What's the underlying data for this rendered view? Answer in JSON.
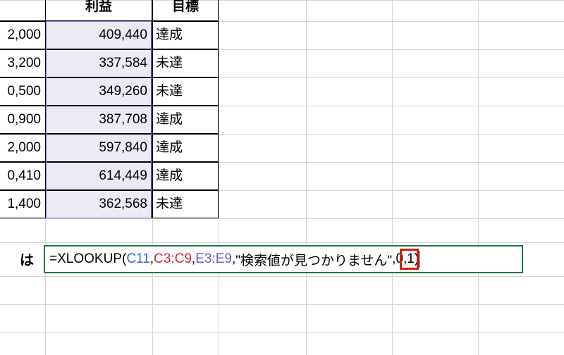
{
  "headers": {
    "profit": "利益",
    "target": "目標"
  },
  "rows": [
    {
      "colA": "2,000",
      "profit": "409,440",
      "target": "達成"
    },
    {
      "colA": "3,200",
      "profit": "337,584",
      "target": "未達"
    },
    {
      "colA": "0,500",
      "profit": "349,260",
      "target": "未達"
    },
    {
      "colA": "0,900",
      "profit": "387,708",
      "target": "達成"
    },
    {
      "colA": "2,000",
      "profit": "597,840",
      "target": "達成"
    },
    {
      "colA": "0,410",
      "profit": "614,449",
      "target": "達成"
    },
    {
      "colA": "1,400",
      "profit": "362,568",
      "target": "未達"
    }
  ],
  "label_fragment": "は",
  "formula": {
    "eq": "=",
    "fn": "XLOOKUP",
    "open": "(",
    "arg1": "C11",
    "c1": ",",
    "arg2": "C3:C9",
    "c2": ",",
    "arg3": "E3:E9",
    "c3": ",",
    "arg4": "\"検索値が見つかりません\"",
    "c4": ",",
    "arg5": "0",
    "c5": ",",
    "arg6": "1",
    "close": ")"
  }
}
